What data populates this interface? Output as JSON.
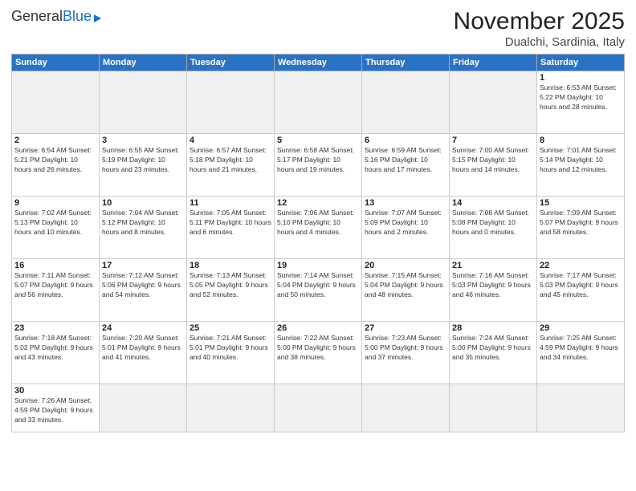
{
  "logo": {
    "general": "General",
    "blue": "Blue"
  },
  "title": "November 2025",
  "location": "Dualchi, Sardinia, Italy",
  "weekdays": [
    "Sunday",
    "Monday",
    "Tuesday",
    "Wednesday",
    "Thursday",
    "Friday",
    "Saturday"
  ],
  "weeks": [
    [
      {
        "day": "",
        "info": ""
      },
      {
        "day": "",
        "info": ""
      },
      {
        "day": "",
        "info": ""
      },
      {
        "day": "",
        "info": ""
      },
      {
        "day": "",
        "info": ""
      },
      {
        "day": "",
        "info": ""
      },
      {
        "day": "1",
        "info": "Sunrise: 6:53 AM\nSunset: 5:22 PM\nDaylight: 10 hours\nand 28 minutes."
      }
    ],
    [
      {
        "day": "2",
        "info": "Sunrise: 6:54 AM\nSunset: 5:21 PM\nDaylight: 10 hours\nand 26 minutes."
      },
      {
        "day": "3",
        "info": "Sunrise: 6:55 AM\nSunset: 5:19 PM\nDaylight: 10 hours\nand 23 minutes."
      },
      {
        "day": "4",
        "info": "Sunrise: 6:57 AM\nSunset: 5:18 PM\nDaylight: 10 hours\nand 21 minutes."
      },
      {
        "day": "5",
        "info": "Sunrise: 6:58 AM\nSunset: 5:17 PM\nDaylight: 10 hours\nand 19 minutes."
      },
      {
        "day": "6",
        "info": "Sunrise: 6:59 AM\nSunset: 5:16 PM\nDaylight: 10 hours\nand 17 minutes."
      },
      {
        "day": "7",
        "info": "Sunrise: 7:00 AM\nSunset: 5:15 PM\nDaylight: 10 hours\nand 14 minutes."
      },
      {
        "day": "8",
        "info": "Sunrise: 7:01 AM\nSunset: 5:14 PM\nDaylight: 10 hours\nand 12 minutes."
      }
    ],
    [
      {
        "day": "9",
        "info": "Sunrise: 7:02 AM\nSunset: 5:13 PM\nDaylight: 10 hours\nand 10 minutes."
      },
      {
        "day": "10",
        "info": "Sunrise: 7:04 AM\nSunset: 5:12 PM\nDaylight: 10 hours\nand 8 minutes."
      },
      {
        "day": "11",
        "info": "Sunrise: 7:05 AM\nSunset: 5:11 PM\nDaylight: 10 hours\nand 6 minutes."
      },
      {
        "day": "12",
        "info": "Sunrise: 7:06 AM\nSunset: 5:10 PM\nDaylight: 10 hours\nand 4 minutes."
      },
      {
        "day": "13",
        "info": "Sunrise: 7:07 AM\nSunset: 5:09 PM\nDaylight: 10 hours\nand 2 minutes."
      },
      {
        "day": "14",
        "info": "Sunrise: 7:08 AM\nSunset: 5:08 PM\nDaylight: 10 hours\nand 0 minutes."
      },
      {
        "day": "15",
        "info": "Sunrise: 7:09 AM\nSunset: 5:07 PM\nDaylight: 9 hours\nand 58 minutes."
      }
    ],
    [
      {
        "day": "16",
        "info": "Sunrise: 7:11 AM\nSunset: 5:07 PM\nDaylight: 9 hours\nand 56 minutes."
      },
      {
        "day": "17",
        "info": "Sunrise: 7:12 AM\nSunset: 5:06 PM\nDaylight: 9 hours\nand 54 minutes."
      },
      {
        "day": "18",
        "info": "Sunrise: 7:13 AM\nSunset: 5:05 PM\nDaylight: 9 hours\nand 52 minutes."
      },
      {
        "day": "19",
        "info": "Sunrise: 7:14 AM\nSunset: 5:04 PM\nDaylight: 9 hours\nand 50 minutes."
      },
      {
        "day": "20",
        "info": "Sunrise: 7:15 AM\nSunset: 5:04 PM\nDaylight: 9 hours\nand 48 minutes."
      },
      {
        "day": "21",
        "info": "Sunrise: 7:16 AM\nSunset: 5:03 PM\nDaylight: 9 hours\nand 46 minutes."
      },
      {
        "day": "22",
        "info": "Sunrise: 7:17 AM\nSunset: 5:03 PM\nDaylight: 9 hours\nand 45 minutes."
      }
    ],
    [
      {
        "day": "23",
        "info": "Sunrise: 7:18 AM\nSunset: 5:02 PM\nDaylight: 9 hours\nand 43 minutes."
      },
      {
        "day": "24",
        "info": "Sunrise: 7:20 AM\nSunset: 5:01 PM\nDaylight: 9 hours\nand 41 minutes."
      },
      {
        "day": "25",
        "info": "Sunrise: 7:21 AM\nSunset: 5:01 PM\nDaylight: 9 hours\nand 40 minutes."
      },
      {
        "day": "26",
        "info": "Sunrise: 7:22 AM\nSunset: 5:00 PM\nDaylight: 9 hours\nand 38 minutes."
      },
      {
        "day": "27",
        "info": "Sunrise: 7:23 AM\nSunset: 5:00 PM\nDaylight: 9 hours\nand 37 minutes."
      },
      {
        "day": "28",
        "info": "Sunrise: 7:24 AM\nSunset: 5:00 PM\nDaylight: 9 hours\nand 35 minutes."
      },
      {
        "day": "29",
        "info": "Sunrise: 7:25 AM\nSunset: 4:59 PM\nDaylight: 9 hours\nand 34 minutes."
      }
    ],
    [
      {
        "day": "30",
        "info": "Sunrise: 7:26 AM\nSunset: 4:59 PM\nDaylight: 9 hours\nand 33 minutes."
      },
      {
        "day": "",
        "info": ""
      },
      {
        "day": "",
        "info": ""
      },
      {
        "day": "",
        "info": ""
      },
      {
        "day": "",
        "info": ""
      },
      {
        "day": "",
        "info": ""
      },
      {
        "day": "",
        "info": ""
      }
    ]
  ]
}
